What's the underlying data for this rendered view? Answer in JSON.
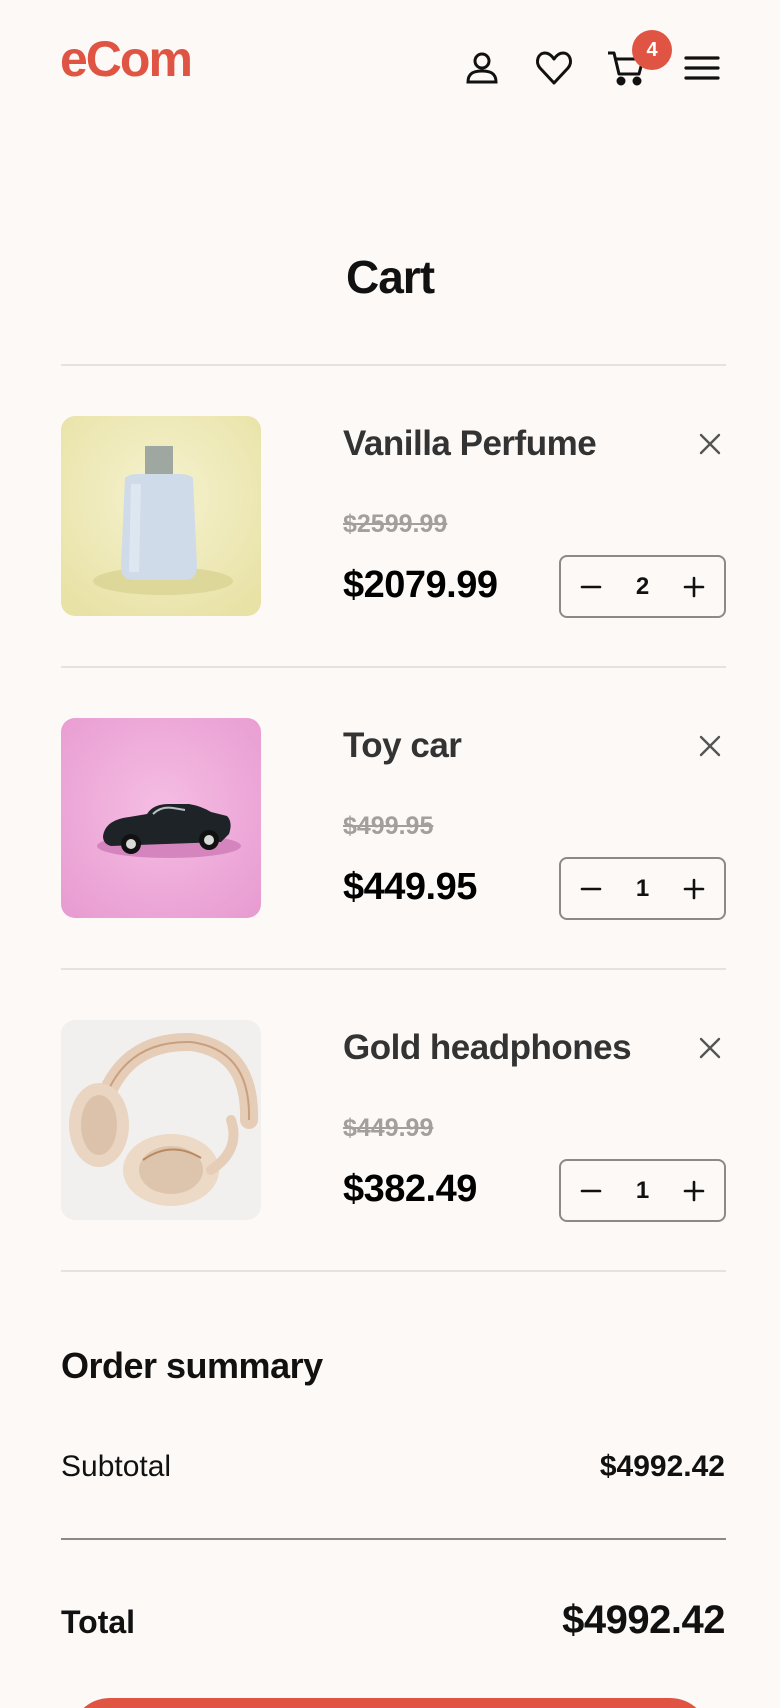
{
  "brand": {
    "logo": "eCom",
    "accent": "#e05443"
  },
  "header": {
    "icons": [
      "user-icon",
      "heart-icon",
      "cart-icon",
      "menu-icon"
    ],
    "cart_count": "4"
  },
  "page": {
    "title": "Cart"
  },
  "items": [
    {
      "name": "Vanilla Perfume",
      "old_price": "$2599.99",
      "price": "$2079.99",
      "qty": "2"
    },
    {
      "name": "Toy car",
      "old_price": "$499.95",
      "price": "$449.95",
      "qty": "1"
    },
    {
      "name": "Gold headphones",
      "old_price": "$449.99",
      "price": "$382.49",
      "qty": "1"
    }
  ],
  "summary": {
    "title": "Order summary",
    "subtotal_label": "Subtotal",
    "subtotal_value": "$4992.42",
    "total_label": "Total",
    "total_value": "$4992.42"
  }
}
